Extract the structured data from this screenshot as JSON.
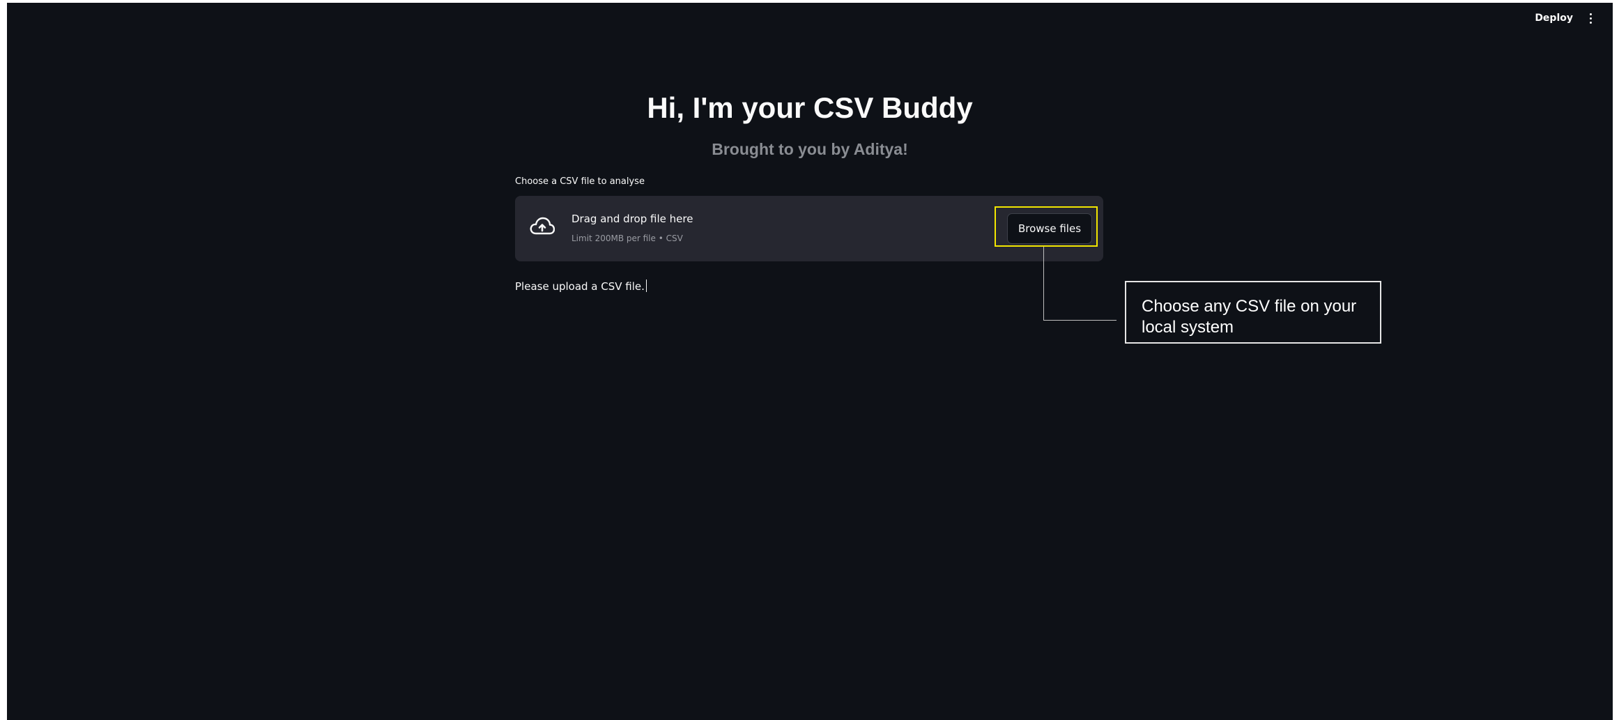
{
  "header": {
    "deploy_label": "Deploy",
    "menu_icon": "vertical-ellipsis-icon"
  },
  "main": {
    "title": "Hi, I'm your CSV Buddy",
    "subtitle": "Brought to you by Aditya!",
    "uploader": {
      "label": "Choose a CSV file to analyse",
      "icon": "cloud-upload-icon",
      "dropzone_title": "Drag and drop file here",
      "dropzone_limit": "Limit 200MB per file • CSV",
      "browse_label": "Browse files"
    },
    "status_message": "Please upload a CSV file."
  },
  "annotation": {
    "callout_text": "Choose any CSV file on your local system",
    "highlight_color": "#f2e600"
  },
  "colors": {
    "background": "#0e1117",
    "dropzone": "#262730",
    "text": "#fafafa",
    "muted_text": "#8a8d93"
  }
}
